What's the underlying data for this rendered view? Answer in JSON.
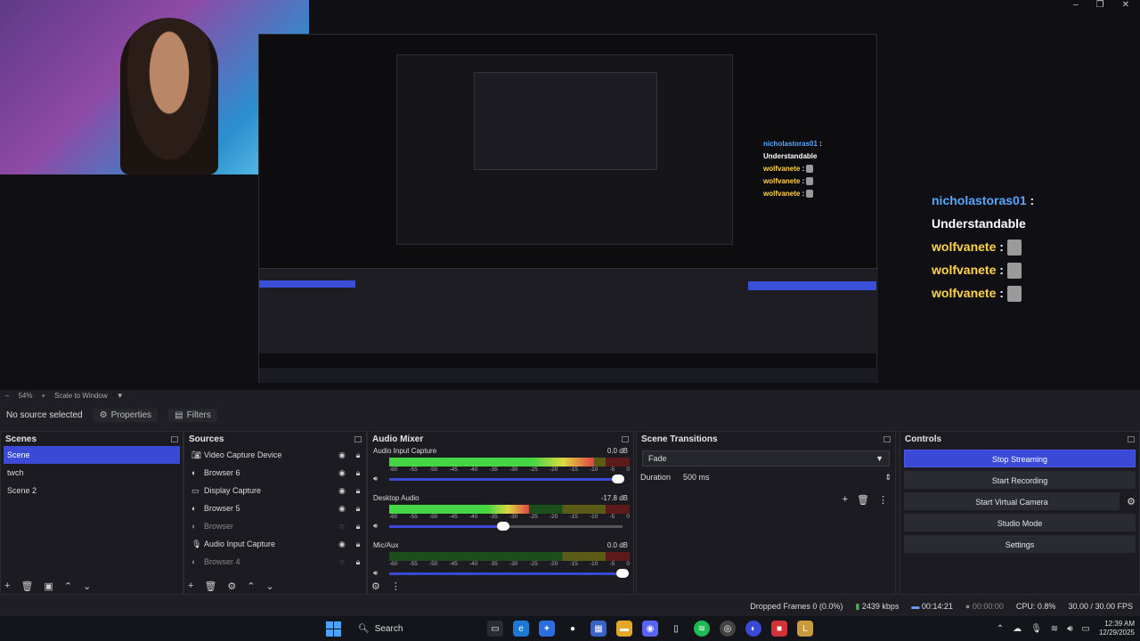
{
  "window": {
    "minimize": "–",
    "maximize": "❐",
    "close": "✕"
  },
  "chat_big": {
    "user1": "nicholastoras01",
    "sep": " :",
    "msg1": "Understandable",
    "user2": "wolfvanete",
    "user3": "wolfvanete",
    "user4": "wolfvanete",
    "colon": " : "
  },
  "chat_small": {
    "user1": "nicholastoras01",
    "sep": " :",
    "msg1": "Understandable",
    "user2": "wolfvanete",
    "user3": "wolfvanete",
    "user4": "wolfvanete",
    "colon": " : "
  },
  "zoom": {
    "zoom_level": "54%",
    "scale_mode": "Scale to Window"
  },
  "propbar": {
    "no_source": "No source selected",
    "properties": "Properties",
    "filters": "Filters"
  },
  "scenes": {
    "title": "Scenes",
    "items": [
      "Scene",
      "twch",
      "Scene 2"
    ]
  },
  "sources": {
    "title": "Sources",
    "items": [
      {
        "name": "Video Capture Device",
        "icon": "camera-icon"
      },
      {
        "name": "Browser 6",
        "icon": "globe-icon"
      },
      {
        "name": "Display Capture",
        "icon": "monitor-icon"
      },
      {
        "name": "Browser 5",
        "icon": "globe-icon"
      },
      {
        "name": "Browser",
        "icon": "globe-icon"
      },
      {
        "name": "Audio Input Capture",
        "icon": "mic-icon"
      },
      {
        "name": "Browser 4",
        "icon": "globe-icon"
      }
    ]
  },
  "mixer": {
    "title": "Audio Mixer",
    "channels": [
      {
        "name": "Audio Input Capture",
        "db": "0.0 dB",
        "level": 0.85,
        "volume": 0.98
      },
      {
        "name": "Desktop Audio",
        "db": "-17.8 dB",
        "level": 0.58,
        "volume": 0.49
      },
      {
        "name": "Mic/Aux",
        "db": "0.0 dB",
        "level": 0.0,
        "volume": 1.0
      }
    ],
    "scale": [
      "-60",
      "-55",
      "-50",
      "-45",
      "-40",
      "-35",
      "-30",
      "-25",
      "-20",
      "-15",
      "-10",
      "-5",
      "0"
    ]
  },
  "transitions": {
    "title": "Scene Transitions",
    "selected": "Fade",
    "duration_label": "Duration",
    "duration_value": "500 ms"
  },
  "controls": {
    "title": "Controls",
    "stop_streaming": "Stop Streaming",
    "start_recording": "Start Recording",
    "start_virtual_camera": "Start Virtual Camera",
    "studio_mode": "Studio Mode",
    "settings": "Settings"
  },
  "status": {
    "dropped": "Dropped Frames 0 (0.0%)",
    "kbps": "2439 kbps",
    "stream_time": "00:14:21",
    "rec_time": "00:00:00",
    "cpu": "CPU: 0.8%",
    "fps": "30.00 / 30.00 FPS"
  },
  "taskbar": {
    "search": "Search",
    "time": "12:39 AM",
    "date": "12/29/2025"
  },
  "colors": {
    "accent": "#3b4ad6",
    "panel": "#1b1b21"
  }
}
